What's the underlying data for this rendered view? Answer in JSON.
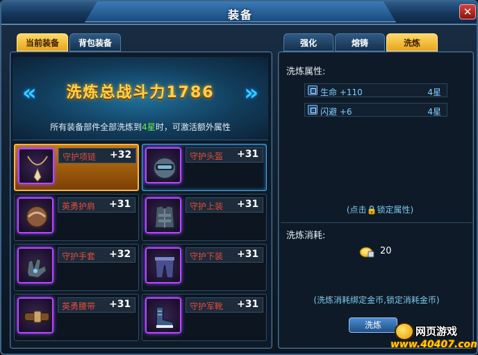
{
  "window": {
    "title": "装备",
    "close_icon": "close-icon"
  },
  "left_tabs": [
    {
      "label": "当前装备",
      "active": true
    },
    {
      "label": "背包装备",
      "active": false
    }
  ],
  "right_tabs": [
    {
      "label": "强化",
      "active": false
    },
    {
      "label": "熔铸",
      "active": false
    },
    {
      "label": "洗炼",
      "active": true
    }
  ],
  "banner": {
    "title": "洗炼总战斗力1786",
    "sub_prefix": "所有装备部件全部洗炼到",
    "sub_highlight": "4星",
    "sub_suffix": "时，可激活额外属性"
  },
  "equipment": [
    {
      "name": "守护项链",
      "value": "+32",
      "icon": "necklace-icon"
    },
    {
      "name": "守护头盔",
      "value": "+31",
      "icon": "helmet-icon"
    },
    {
      "name": "英勇护肩",
      "value": "+31",
      "icon": "shoulder-guard-icon"
    },
    {
      "name": "守护上装",
      "value": "+31",
      "icon": "chest-armor-icon"
    },
    {
      "name": "守护手套",
      "value": "+32",
      "icon": "gloves-icon"
    },
    {
      "name": "守护下装",
      "value": "+31",
      "icon": "pants-icon"
    },
    {
      "name": "英勇腰带",
      "value": "+31",
      "icon": "belt-icon"
    },
    {
      "name": "守护军靴",
      "value": "+31",
      "icon": "boots-icon"
    }
  ],
  "wash_panel": {
    "attr_label": "洗炼属性:",
    "attributes": [
      {
        "name": "生命 +110",
        "stars": "4星"
      },
      {
        "name": "闪避 +6",
        "stars": "4星"
      }
    ],
    "lock_hint_prefix": "(点击",
    "lock_hint_suffix": "锁定属性)",
    "cost_label": "洗炼消耗:",
    "cost_value": "20",
    "cost_hint": "(洗炼消耗绑定金币,锁定消耗金币)",
    "button_label": "洗炼"
  },
  "watermark": {
    "top": "网页游戏",
    "bottom": "www.40407.com"
  },
  "colors": {
    "accent": "#ffd24a",
    "slot_name": "#e04c3c",
    "attr_text": "#7fd0ff",
    "highlight_green": "#6cf04a"
  }
}
